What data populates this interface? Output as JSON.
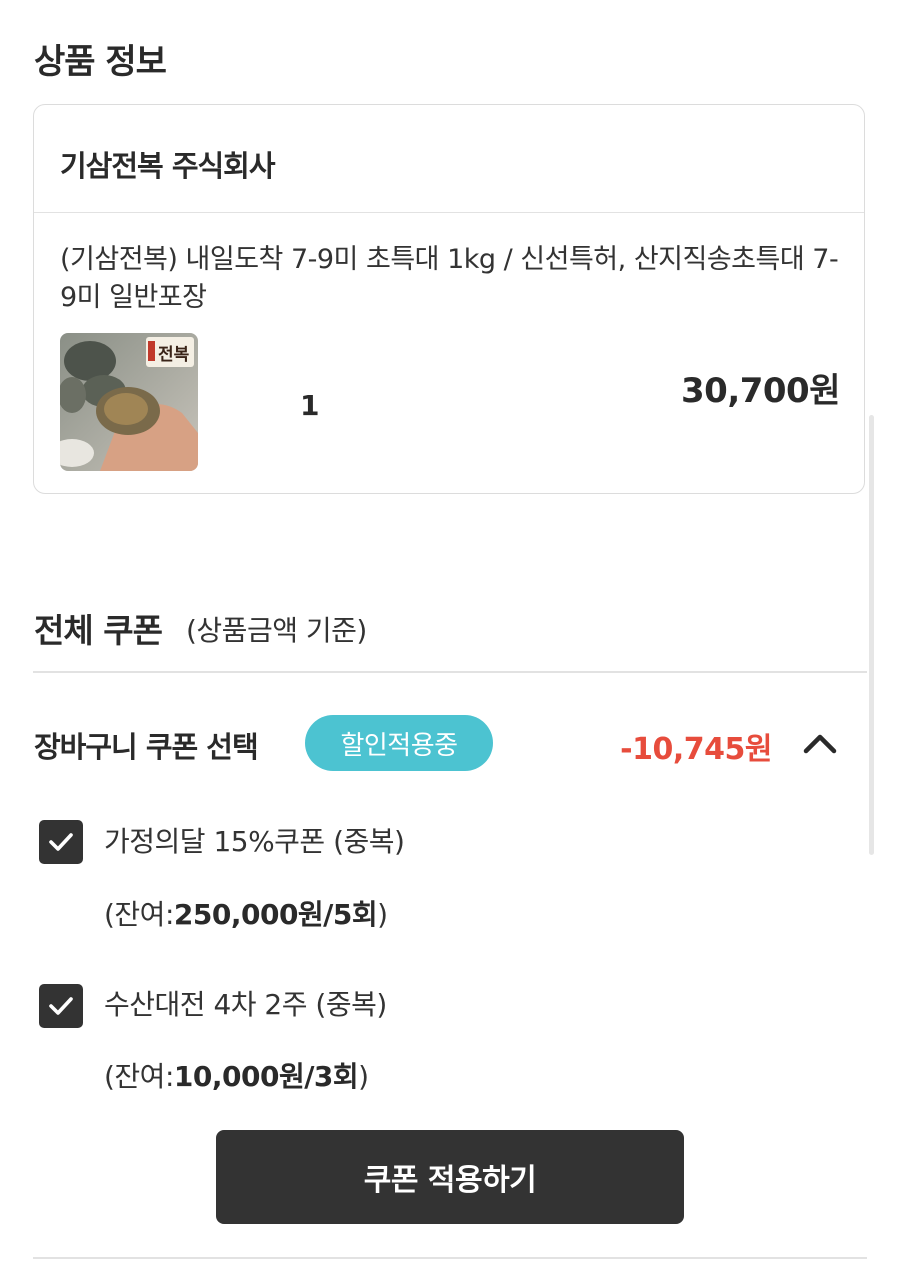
{
  "product_section": {
    "title": "상품 정보",
    "seller": "기삼전복 주식회사",
    "product_name": "(기삼전복) 내일도착 7-9미 초특대 1kg / 신선특허, 산지직송초특대 7-9미 일반포장",
    "thumbnail_logo_text": "전복",
    "quantity": "1",
    "price": "30,700원"
  },
  "coupon_section": {
    "title": "전체 쿠폰",
    "subtitle": "(상품금액 기준)",
    "cart_coupon_label": "장바구니 쿠폰 선택",
    "badge": "할인적용중",
    "discount": "-10,745원",
    "coupons": [
      {
        "name": "가정의달 15%쿠폰 (중복)",
        "remain_prefix": "(잔여:",
        "remain_value": "250,000원/5회",
        "remain_suffix": ")",
        "checked": true
      },
      {
        "name": "수산대전 4차 2주 (중복)",
        "remain_prefix": "(잔여:",
        "remain_value": "10,000원/3회",
        "remain_suffix": ")",
        "checked": true
      }
    ],
    "apply_button": "쿠폰 적용하기"
  },
  "colors": {
    "badge": "#4cc3d1",
    "discount": "#e74c3c",
    "dark": "#333333"
  },
  "icons": {
    "collapse": "chevron-up-icon",
    "check": "check-icon"
  }
}
